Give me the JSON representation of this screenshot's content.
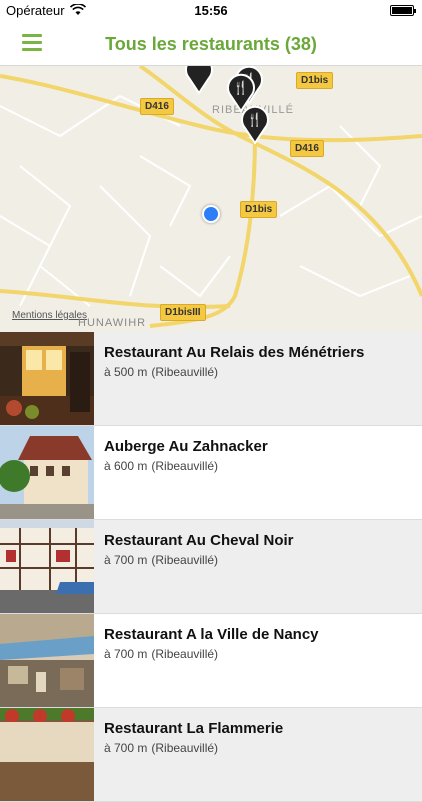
{
  "status_bar": {
    "carrier": "Opérateur",
    "time": "15:56",
    "wifi_icon": "wifi-icon",
    "battery_icon": "battery-icon"
  },
  "nav": {
    "title": "Tous les restaurants (38)",
    "menu_icon": "hamburger-menu-icon",
    "accent_color": "#6aa83a"
  },
  "map": {
    "legal_link": "Mentions légales",
    "town_label": "HUNAWIHR",
    "city_label": "RIBEAUVILLÉ",
    "roads": [
      "D416",
      "D1bis",
      "D416",
      "D1bis",
      "D1bisIII"
    ],
    "pin_icon": "restaurant-pin-icon",
    "user_location_color": "#2c7ef8"
  },
  "restaurants": [
    {
      "name": "Restaurant Au Relais des Ménétriers",
      "distance": "à 500 m",
      "town": "(Ribeauvillé)"
    },
    {
      "name": "Auberge Au Zahnacker",
      "distance": "à 600 m",
      "town": "(Ribeauvillé)"
    },
    {
      "name": "Restaurant Au Cheval Noir",
      "distance": "à 700 m",
      "town": "(Ribeauvillé)"
    },
    {
      "name": "Restaurant A la Ville de Nancy",
      "distance": "à 700 m",
      "town": "(Ribeauvillé)"
    },
    {
      "name": "Restaurant La Flammerie",
      "distance": "à 700 m",
      "town": "(Ribeauvillé)"
    }
  ]
}
